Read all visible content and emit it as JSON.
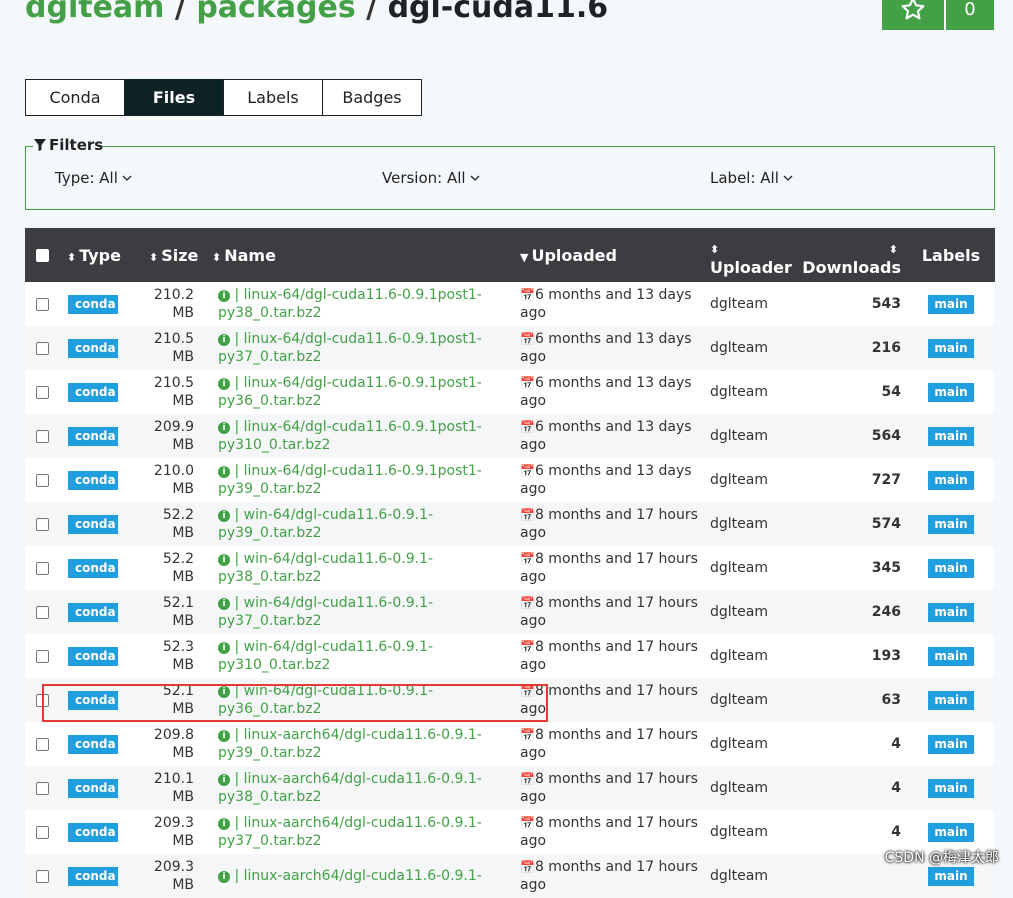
{
  "breadcrumb": {
    "owner": "dglteam",
    "sep1": "/",
    "section": "packages",
    "sep2": "/",
    "package": "dgl-cuda11.6"
  },
  "star": {
    "icon": "star-icon",
    "count": "0"
  },
  "tabs": [
    "Conda",
    "Files",
    "Labels",
    "Badges"
  ],
  "active_tab": "Files",
  "filters": {
    "legend": "Filters",
    "type": "Type: All",
    "version": "Version: All",
    "label": "Label: All"
  },
  "table": {
    "headers": {
      "type": "Type",
      "size": "Size",
      "name": "Name",
      "uploaded": "Uploaded",
      "uploader": "Uploader",
      "downloads": "Downloads",
      "labels": "Labels"
    },
    "rows": [
      {
        "type": "conda",
        "size": "210.2 MB",
        "name": "| linux-64/dgl-cuda11.6-0.9.1post1-py38_0.tar.bz2",
        "uploaded": "6 months and 13 days ago",
        "uploader": "dglteam",
        "downloads": "543",
        "label": "main"
      },
      {
        "type": "conda",
        "size": "210.5 MB",
        "name": "| linux-64/dgl-cuda11.6-0.9.1post1-py37_0.tar.bz2",
        "uploaded": "6 months and 13 days ago",
        "uploader": "dglteam",
        "downloads": "216",
        "label": "main"
      },
      {
        "type": "conda",
        "size": "210.5 MB",
        "name": "| linux-64/dgl-cuda11.6-0.9.1post1-py36_0.tar.bz2",
        "uploaded": "6 months and 13 days ago",
        "uploader": "dglteam",
        "downloads": "54",
        "label": "main"
      },
      {
        "type": "conda",
        "size": "209.9 MB",
        "name": "| linux-64/dgl-cuda11.6-0.9.1post1-py310_0.tar.bz2",
        "uploaded": "6 months and 13 days ago",
        "uploader": "dglteam",
        "downloads": "564",
        "label": "main"
      },
      {
        "type": "conda",
        "size": "210.0 MB",
        "name": "| linux-64/dgl-cuda11.6-0.9.1post1-py39_0.tar.bz2",
        "uploaded": "6 months and 13 days ago",
        "uploader": "dglteam",
        "downloads": "727",
        "label": "main"
      },
      {
        "type": "conda",
        "size": "52.2 MB",
        "name": "| win-64/dgl-cuda11.6-0.9.1-py39_0.tar.bz2",
        "uploaded": "8 months and 17 hours ago",
        "uploader": "dglteam",
        "downloads": "574",
        "label": "main"
      },
      {
        "type": "conda",
        "size": "52.2 MB",
        "name": "| win-64/dgl-cuda11.6-0.9.1-py38_0.tar.bz2",
        "uploaded": "8 months and 17 hours ago",
        "uploader": "dglteam",
        "downloads": "345",
        "label": "main"
      },
      {
        "type": "conda",
        "size": "52.1 MB",
        "name": "| win-64/dgl-cuda11.6-0.9.1-py37_0.tar.bz2",
        "uploaded": "8 months and 17 hours ago",
        "uploader": "dglteam",
        "downloads": "246",
        "label": "main"
      },
      {
        "type": "conda",
        "size": "52.3 MB",
        "name": "| win-64/dgl-cuda11.6-0.9.1-py310_0.tar.bz2",
        "uploaded": "8 months and 17 hours ago",
        "uploader": "dglteam",
        "downloads": "193",
        "label": "main"
      },
      {
        "type": "conda",
        "size": "52.1 MB",
        "name": "| win-64/dgl-cuda11.6-0.9.1-py36_0.tar.bz2",
        "uploaded": "8 months and 17 hours ago",
        "uploader": "dglteam",
        "downloads": "63",
        "label": "main"
      },
      {
        "type": "conda",
        "size": "209.8 MB",
        "name": "| linux-aarch64/dgl-cuda11.6-0.9.1-py39_0.tar.bz2",
        "uploaded": "8 months and 17 hours ago",
        "uploader": "dglteam",
        "downloads": "4",
        "label": "main"
      },
      {
        "type": "conda",
        "size": "210.1 MB",
        "name": "| linux-aarch64/dgl-cuda11.6-0.9.1-py38_0.tar.bz2",
        "uploaded": "8 months and 17 hours ago",
        "uploader": "dglteam",
        "downloads": "4",
        "label": "main"
      },
      {
        "type": "conda",
        "size": "209.3 MB",
        "name": "| linux-aarch64/dgl-cuda11.6-0.9.1-py37_0.tar.bz2",
        "uploaded": "8 months and 17 hours ago",
        "uploader": "dglteam",
        "downloads": "4",
        "label": "main"
      },
      {
        "type": "conda",
        "size": "209.3 MB",
        "name": "| linux-aarch64/dgl-cuda11.6-0.9.1-",
        "uploaded": "8 months and 17 hours ago",
        "uploader": "dglteam",
        "downloads": "",
        "label": "main"
      }
    ]
  },
  "watermark": "CSDN @梅津太郎",
  "colors": {
    "green": "#43a047",
    "header_bg": "#3b3d40",
    "badge_blue": "#1f9ee0",
    "highlight": "#e53935"
  }
}
